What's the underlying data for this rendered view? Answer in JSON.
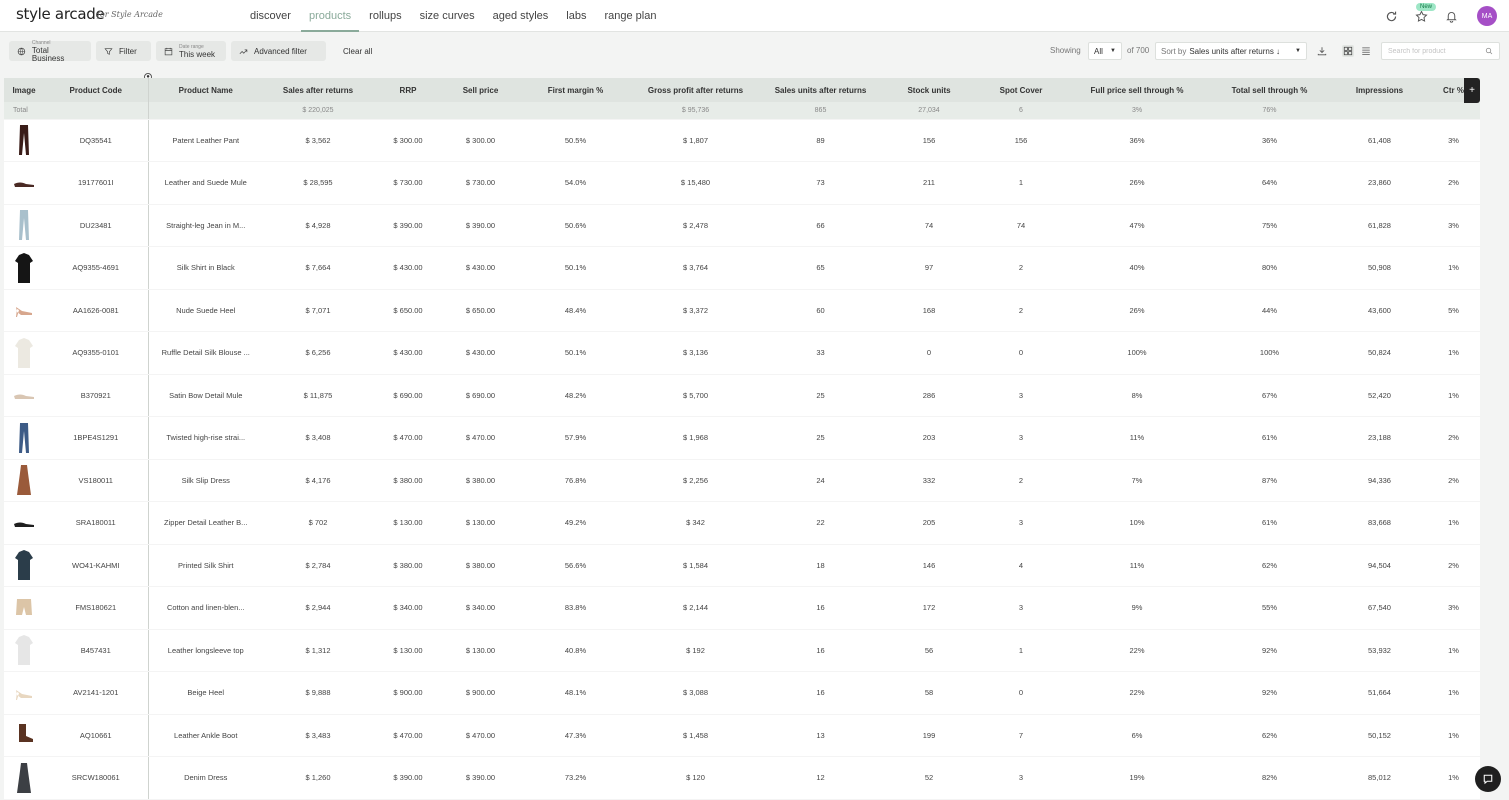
{
  "app": {
    "logo": "style arcade",
    "logo_sub": "for Style Arcade",
    "nav": [
      "discover",
      "products",
      "rollups",
      "size curves",
      "aged styles",
      "labs",
      "range plan"
    ],
    "new_badge": "New",
    "avatar": "MA"
  },
  "toolbar": {
    "channel_label": "Channel",
    "channel_value": "Total Business",
    "filter": "Filter",
    "date_label": "Date range",
    "date_value": "This week",
    "advanced_filter": "Advanced filter",
    "clear_all": "Clear all",
    "showing": "Showing",
    "showing_value": "All",
    "of_total": "of 700",
    "sort_prefix": "Sort by",
    "sort_value": "Sales units after returns ↓",
    "search_placeholder": "Search for product"
  },
  "table": {
    "columns": [
      "Image",
      "Product Code",
      "Product Name",
      "Sales after returns",
      "RRP",
      "Sell price",
      "First margin %",
      "Gross profit after returns",
      "Sales units after returns",
      "Stock units",
      "Spot Cover",
      "Full price sell through %",
      "Total sell through %",
      "Impressions",
      "Ctr %"
    ],
    "total": [
      "Total",
      "",
      "",
      "$ 220,025",
      "",
      "",
      "",
      "$ 95,736",
      "865",
      "27,034",
      "6",
      "3%",
      "76%",
      "",
      ""
    ],
    "rows": [
      {
        "thumb": "pants-dark",
        "code": "DQ35541",
        "name": "Patent Leather Pant",
        "sales": "$ 3,562",
        "rrp": "$ 300.00",
        "sell": "$ 300.00",
        "fm": "50.5%",
        "gp": "$ 1,807",
        "units": "89",
        "stock": "156",
        "spot": "156",
        "fp": "36%",
        "ts": "36%",
        "imp": "61,408",
        "ctr": "3%"
      },
      {
        "thumb": "mule-dark",
        "code": "19177601I",
        "name": "Leather and Suede Mule",
        "sales": "$ 28,595",
        "rrp": "$ 730.00",
        "sell": "$ 730.00",
        "fm": "54.0%",
        "gp": "$ 15,480",
        "units": "73",
        "stock": "211",
        "spot": "1",
        "fp": "26%",
        "ts": "64%",
        "imp": "23,860",
        "ctr": "2%"
      },
      {
        "thumb": "jeans-light",
        "code": "DU23481",
        "name": "Straight-leg Jean in M...",
        "sales": "$ 4,928",
        "rrp": "$ 390.00",
        "sell": "$ 390.00",
        "fm": "50.6%",
        "gp": "$ 2,478",
        "units": "66",
        "stock": "74",
        "spot": "74",
        "fp": "47%",
        "ts": "75%",
        "imp": "61,828",
        "ctr": "3%"
      },
      {
        "thumb": "shirt-black",
        "code": "AQ9355-4691",
        "name": "Silk Shirt in Black",
        "sales": "$ 7,664",
        "rrp": "$ 430.00",
        "sell": "$ 430.00",
        "fm": "50.1%",
        "gp": "$ 3,764",
        "units": "65",
        "stock": "97",
        "spot": "2",
        "fp": "40%",
        "ts": "80%",
        "imp": "50,908",
        "ctr": "1%"
      },
      {
        "thumb": "heel-nude",
        "code": "AA1626-0081",
        "name": "Nude Suede Heel",
        "sales": "$ 7,071",
        "rrp": "$ 650.00",
        "sell": "$ 650.00",
        "fm": "48.4%",
        "gp": "$ 3,372",
        "units": "60",
        "stock": "168",
        "spot": "2",
        "fp": "26%",
        "ts": "44%",
        "imp": "43,600",
        "ctr": "5%"
      },
      {
        "thumb": "blouse-white",
        "code": "AQ9355-0101",
        "name": "Ruffle Detail Silk Blouse ...",
        "sales": "$ 6,256",
        "rrp": "$ 430.00",
        "sell": "$ 430.00",
        "fm": "50.1%",
        "gp": "$ 3,136",
        "units": "33",
        "stock": "0",
        "spot": "0",
        "fp": "100%",
        "ts": "100%",
        "imp": "50,824",
        "ctr": "1%"
      },
      {
        "thumb": "mule-light",
        "code": "B370921",
        "name": "Satin Bow Detail Mule",
        "sales": "$ 11,875",
        "rrp": "$ 690.00",
        "sell": "$ 690.00",
        "fm": "48.2%",
        "gp": "$ 5,700",
        "units": "25",
        "stock": "286",
        "spot": "3",
        "fp": "8%",
        "ts": "67%",
        "imp": "52,420",
        "ctr": "1%"
      },
      {
        "thumb": "jeans-blue",
        "code": "1BPE4S1291",
        "name": "Twisted high-rise strai...",
        "sales": "$ 3,408",
        "rrp": "$ 470.00",
        "sell": "$ 470.00",
        "fm": "57.9%",
        "gp": "$ 1,968",
        "units": "25",
        "stock": "203",
        "spot": "3",
        "fp": "11%",
        "ts": "61%",
        "imp": "23,188",
        "ctr": "2%"
      },
      {
        "thumb": "dress-rust",
        "code": "VS180011",
        "name": "Silk Slip Dress",
        "sales": "$ 4,176",
        "rrp": "$ 380.00",
        "sell": "$ 380.00",
        "fm": "76.8%",
        "gp": "$ 2,256",
        "units": "24",
        "stock": "332",
        "spot": "2",
        "fp": "7%",
        "ts": "87%",
        "imp": "94,336",
        "ctr": "2%"
      },
      {
        "thumb": "shoe-black",
        "code": "SRA180011",
        "name": "Zipper Detail Leather B...",
        "sales": "$ 702",
        "rrp": "$ 130.00",
        "sell": "$ 130.00",
        "fm": "49.2%",
        "gp": "$ 342",
        "units": "22",
        "stock": "205",
        "spot": "3",
        "fp": "10%",
        "ts": "61%",
        "imp": "83,668",
        "ctr": "1%"
      },
      {
        "thumb": "shirt-print",
        "code": "WO41-KAHMI",
        "name": "Printed Silk Shirt",
        "sales": "$ 2,784",
        "rrp": "$ 380.00",
        "sell": "$ 380.00",
        "fm": "56.6%",
        "gp": "$ 1,584",
        "units": "18",
        "stock": "146",
        "spot": "4",
        "fp": "11%",
        "ts": "62%",
        "imp": "94,504",
        "ctr": "2%"
      },
      {
        "thumb": "shorts-beige",
        "code": "FMS180621",
        "name": "Cotton and linen-blen...",
        "sales": "$ 2,944",
        "rrp": "$ 340.00",
        "sell": "$ 340.00",
        "fm": "83.8%",
        "gp": "$ 2,144",
        "units": "16",
        "stock": "172",
        "spot": "3",
        "fp": "9%",
        "ts": "55%",
        "imp": "67,540",
        "ctr": "3%"
      },
      {
        "thumb": "top-white",
        "code": "B457431",
        "name": "Leather longsleeve top",
        "sales": "$ 1,312",
        "rrp": "$ 130.00",
        "sell": "$ 130.00",
        "fm": "40.8%",
        "gp": "$ 192",
        "units": "16",
        "stock": "56",
        "spot": "1",
        "fp": "22%",
        "ts": "92%",
        "imp": "53,932",
        "ctr": "1%"
      },
      {
        "thumb": "heel-beige",
        "code": "AV2141-1201",
        "name": "Beige Heel",
        "sales": "$ 9,888",
        "rrp": "$ 900.00",
        "sell": "$ 900.00",
        "fm": "48.1%",
        "gp": "$ 3,088",
        "units": "16",
        "stock": "58",
        "spot": "0",
        "fp": "22%",
        "ts": "92%",
        "imp": "51,664",
        "ctr": "1%"
      },
      {
        "thumb": "boot-brown",
        "code": "AQ10661",
        "name": "Leather Ankle Boot",
        "sales": "$ 3,483",
        "rrp": "$ 470.00",
        "sell": "$ 470.00",
        "fm": "47.3%",
        "gp": "$ 1,458",
        "units": "13",
        "stock": "199",
        "spot": "7",
        "fp": "6%",
        "ts": "62%",
        "imp": "50,152",
        "ctr": "1%"
      },
      {
        "thumb": "dress-denim",
        "code": "SRCW180061",
        "name": "Denim Dress",
        "sales": "$ 1,260",
        "rrp": "$ 390.00",
        "sell": "$ 390.00",
        "fm": "73.2%",
        "gp": "$ 120",
        "units": "12",
        "stock": "52",
        "spot": "3",
        "fp": "19%",
        "ts": "82%",
        "imp": "85,012",
        "ctr": "1%"
      }
    ]
  },
  "colors": {
    "accent": "#8aaa9a",
    "header_bg": "#dfe4e0",
    "avatar": "#a54fc6"
  },
  "icons": [
    "refresh-icon",
    "star-icon",
    "bell-icon",
    "globe-icon",
    "filter-icon",
    "calendar-icon",
    "trend-icon",
    "download-icon",
    "grid-icon",
    "list-icon",
    "search-icon",
    "chat-icon"
  ]
}
